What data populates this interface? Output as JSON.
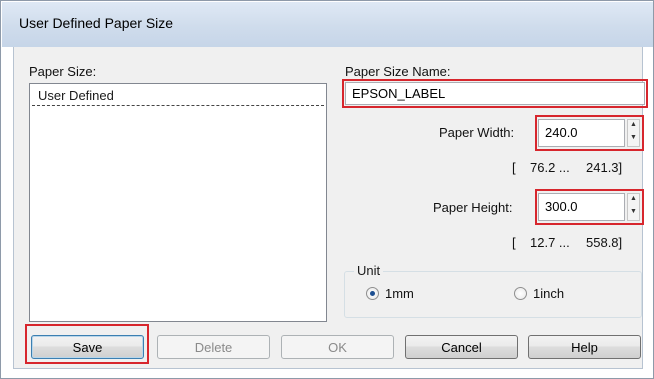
{
  "window": {
    "title": "User Defined Paper Size"
  },
  "paper_size": {
    "label": "Paper Size:",
    "items": [
      "User Defined"
    ]
  },
  "paper_size_name": {
    "label": "Paper Size Name:",
    "value": "EPSON_LABEL"
  },
  "paper_width": {
    "label": "Paper Width:",
    "value": "240.0",
    "range_open": "[",
    "range_min": "76.2 ...",
    "range_max": "241.3]"
  },
  "paper_height": {
    "label": "Paper Height:",
    "value": "300.0",
    "range_open": "[",
    "range_min": "12.7 ...",
    "range_max": "558.8]"
  },
  "unit": {
    "title": "Unit",
    "options": [
      {
        "label": "1mm",
        "selected": true
      },
      {
        "label": "1inch",
        "selected": false
      }
    ]
  },
  "buttons": {
    "save": "Save",
    "delete": "Delete",
    "ok": "OK",
    "cancel": "Cancel",
    "help": "Help"
  },
  "colors": {
    "highlight": "#d7262d",
    "radio_selected": "#1d4f91"
  },
  "icons": {
    "spin_up": "▲",
    "spin_down": "▼"
  }
}
